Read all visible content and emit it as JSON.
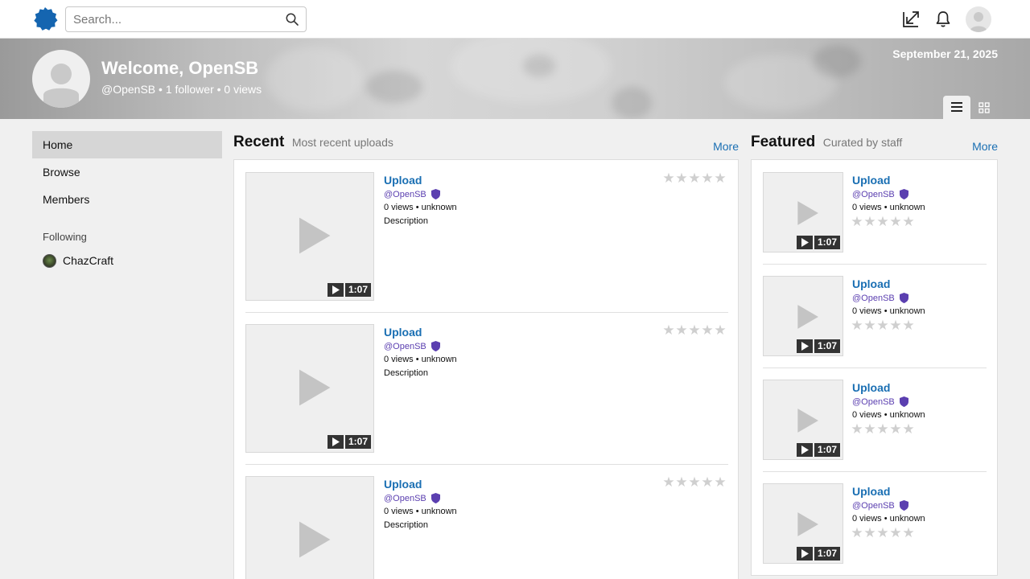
{
  "topbar": {
    "search_placeholder": "Search...",
    "icons": [
      "logo-badge-icon",
      "search-icon",
      "upload-arrow-icon",
      "bell-icon",
      "user-avatar-icon"
    ]
  },
  "banner": {
    "welcome": "Welcome, OpenSB",
    "stats": "@OpenSB • 1 follower • 0 views",
    "date": "September 21, 2025"
  },
  "sidebar": {
    "items": [
      {
        "label": "Home",
        "active": true
      },
      {
        "label": "Browse",
        "active": false
      },
      {
        "label": "Members",
        "active": false
      }
    ],
    "following_heading": "Following",
    "following": [
      {
        "label": "ChazCraft"
      }
    ]
  },
  "recent": {
    "title": "Recent",
    "subtitle": "Most recent uploads",
    "more": "More",
    "items": [
      {
        "title": "Upload",
        "author": "@OpenSB",
        "meta": "0 views • unknown",
        "description": "Description",
        "duration": "1:07",
        "rating": 0
      },
      {
        "title": "Upload",
        "author": "@OpenSB",
        "meta": "0 views • unknown",
        "description": "Description",
        "duration": "1:07",
        "rating": 0
      },
      {
        "title": "Upload",
        "author": "@OpenSB",
        "meta": "0 views • unknown",
        "description": "Description",
        "duration": "1:07",
        "rating": 0
      }
    ]
  },
  "featured": {
    "title": "Featured",
    "subtitle": "Curated by staff",
    "more": "More",
    "items": [
      {
        "title": "Upload",
        "author": "@OpenSB",
        "meta": "0 views • unknown",
        "duration": "1:07",
        "rating": 0
      },
      {
        "title": "Upload",
        "author": "@OpenSB",
        "meta": "0 views • unknown",
        "duration": "1:07",
        "rating": 0
      },
      {
        "title": "Upload",
        "author": "@OpenSB",
        "meta": "0 views • unknown",
        "duration": "1:07",
        "rating": 0
      },
      {
        "title": "Upload",
        "author": "@OpenSB",
        "meta": "0 views • unknown",
        "duration": "1:07",
        "rating": 0
      }
    ]
  },
  "colors": {
    "accent": "#1a6fb3",
    "author": "#5b3fb0",
    "logo": "#1565b0"
  }
}
